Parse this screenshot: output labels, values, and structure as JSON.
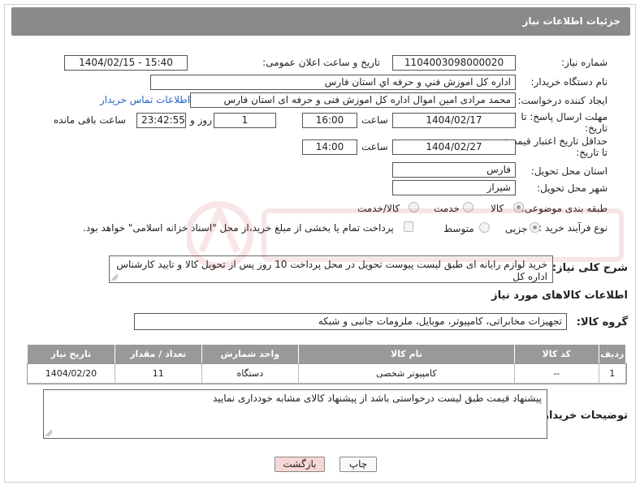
{
  "header": {
    "title": "جزئیات اطلاعات نیاز"
  },
  "fields": {
    "need_number_label": "شماره نیاز:",
    "need_number_value": "1104003098000020",
    "announce_label": "تاریخ و ساعت اعلان عمومی:",
    "announce_value": "1404/02/15 - 15:40",
    "buyer_org_label": "نام دستگاه خریدار:",
    "buyer_org_value": "اداره کل اموزش فني و حرفه اي استان فارس",
    "requester_label": "ایجاد کننده درخواست:",
    "requester_value": "محمد مرادی امین  اموال اداره کل اموزش فنی و حرفه ای استان فارس",
    "contact_link": "اطلاعات تماس خریدار",
    "deadline_label_1": "مهلت ارسال پاسخ: تا",
    "deadline_label_2": "تاریخ:",
    "deadline_date": "1404/02/17",
    "time_word": "ساعت",
    "deadline_time": "16:00",
    "days_value": "1",
    "days_word": "روز و",
    "remaining_time": "23:42:55",
    "remaining_word": "ساعت باقی مانده",
    "price_validity_label_1": "حداقل تاریخ اعتبار قیمت:",
    "price_validity_label_2": "تا تاریخ:",
    "price_validity_date": "1404/02/27",
    "price_validity_time": "14:00",
    "province_label": "استان محل تحویل:",
    "province_value": "فارس",
    "city_label": "شهر محل تحویل:",
    "city_value": "شیراز",
    "category_label": "طبقه بندی موضوعی:",
    "category_options": [
      "کالا",
      "خدمت",
      "کالا/خدمت"
    ],
    "category_selected": "کالا",
    "process_label": "نوع فرآیند خرید :",
    "process_options": [
      "جزیی",
      "متوسط"
    ],
    "process_selected": "جزیی",
    "payment_note": "پرداخت تمام یا بخشی از مبلغ خرید،از محل \"اسناد خزانه اسلامی\" خواهد بود."
  },
  "description": {
    "label": "شرح کلی نیاز:",
    "text": "خرید لوازم رایانه ای طبق لیست پیوست  تحویل در محل پرداخت 10 روز پس از تحویل کالا و تایید کارشناس اداره کل"
  },
  "goods": {
    "section_title": "اطلاعات کالاهای مورد نیاز",
    "group_label": "گروه کالا:",
    "group_value": "تجهیزات مخابراتی، کامپیوتر، موبایل، ملزومات جانبی و شبکه",
    "columns": [
      "ردیف",
      "کد کالا",
      "نام کالا",
      "واحد شمارش",
      "تعداد / مقدار",
      "تاریخ نیاز"
    ],
    "rows": [
      {
        "index": "1",
        "code": "--",
        "name": "کامپیوتر شخصی",
        "unit": "دستگاه",
        "qty": "11",
        "date": "1404/02/20"
      }
    ]
  },
  "buyer_notes": {
    "label": "توضیحات خریدار:",
    "text": "پیشنهاد قیمت طبق لیست درخواستی باشد از پیشنهاد کالای مشابه خودداری نمایید"
  },
  "buttons": {
    "print": "چاپ",
    "back": "بازگشت"
  },
  "colors": {
    "header_bg": "#8a8a8a",
    "table_header_bg": "#999999",
    "link": "#2266cc",
    "back_button": "#f8d7d7"
  }
}
